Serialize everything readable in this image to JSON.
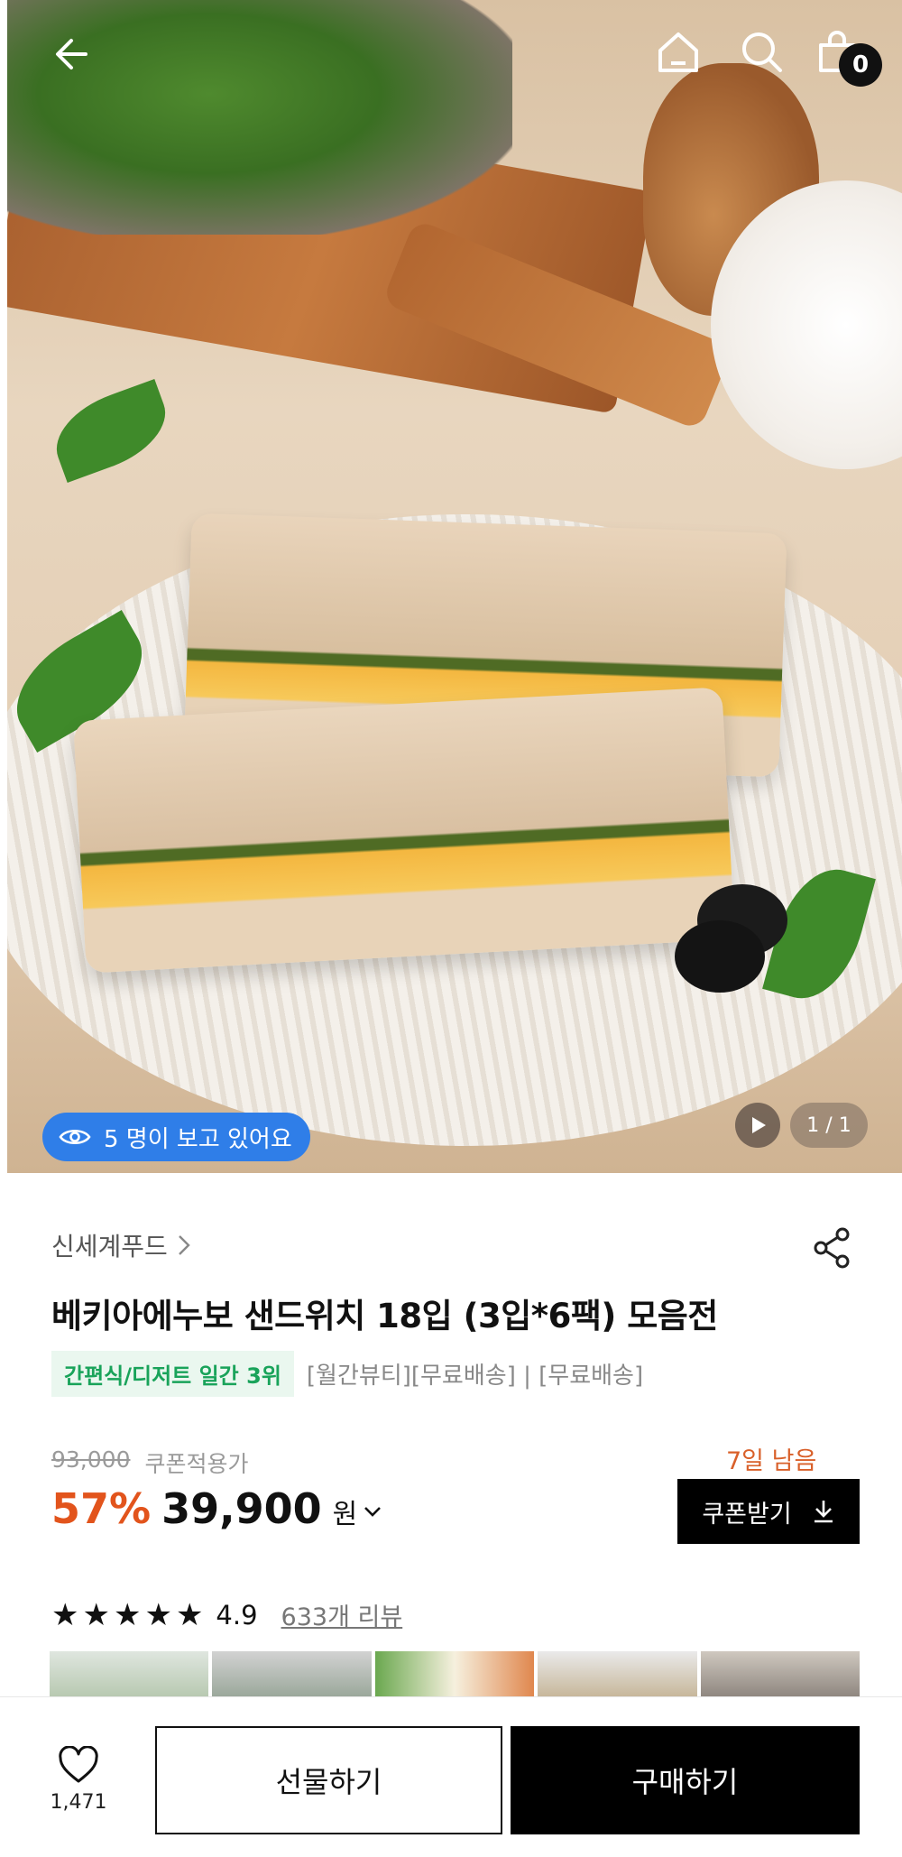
{
  "header": {
    "back_icon": "arrow-left-icon",
    "home_icon": "home-icon",
    "search_icon": "search-icon",
    "cart_icon": "shopping-bag-icon",
    "cart_count": "0"
  },
  "hero": {
    "viewers_text": "5 명이 보고 있어요",
    "viewers_icon": "eye-icon",
    "video_icon": "play-icon",
    "pager": "1 / 1"
  },
  "product": {
    "brand": "신세계푸드",
    "brand_chevron": ">",
    "share_icon": "share-icon",
    "title": "베키아에누보 샌드위치 18입 (3입*6팩) 모음전",
    "rank_badge": "간편식/디저트 일간 3위",
    "tags": "[월간뷰티][무료배송] | [무료배송]",
    "original_price": "93,000",
    "coupon_applied_label": "쿠폰적용가",
    "discount": "57%",
    "price": "39,900",
    "currency": "원",
    "days_left": "7일 남음",
    "coupon_button": "쿠폰받기",
    "rating": "4.9",
    "stars": 5,
    "review_link": "633개 리뷰"
  },
  "bottom": {
    "like_icon": "heart-icon",
    "like_count": "1,471",
    "gift_button": "선물하기",
    "buy_button": "구매하기"
  },
  "colors": {
    "accent_discount": "#e2541c",
    "viewer_badge": "#2f7ee8",
    "rank_green": "#19a35a"
  }
}
